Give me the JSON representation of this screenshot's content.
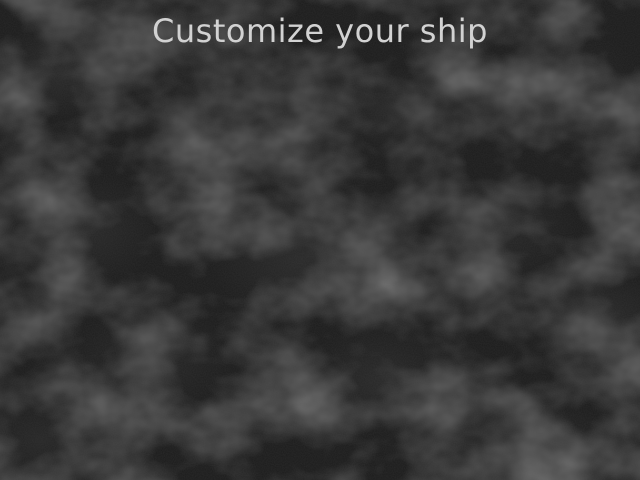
{
  "screen": {
    "title": "Customize your ship",
    "background": "dark-cloud-texture"
  },
  "colors": {
    "background": "#1b1b1b",
    "cloud_highlight": "#3a3a3a",
    "title_text": "#d2d2d2"
  }
}
